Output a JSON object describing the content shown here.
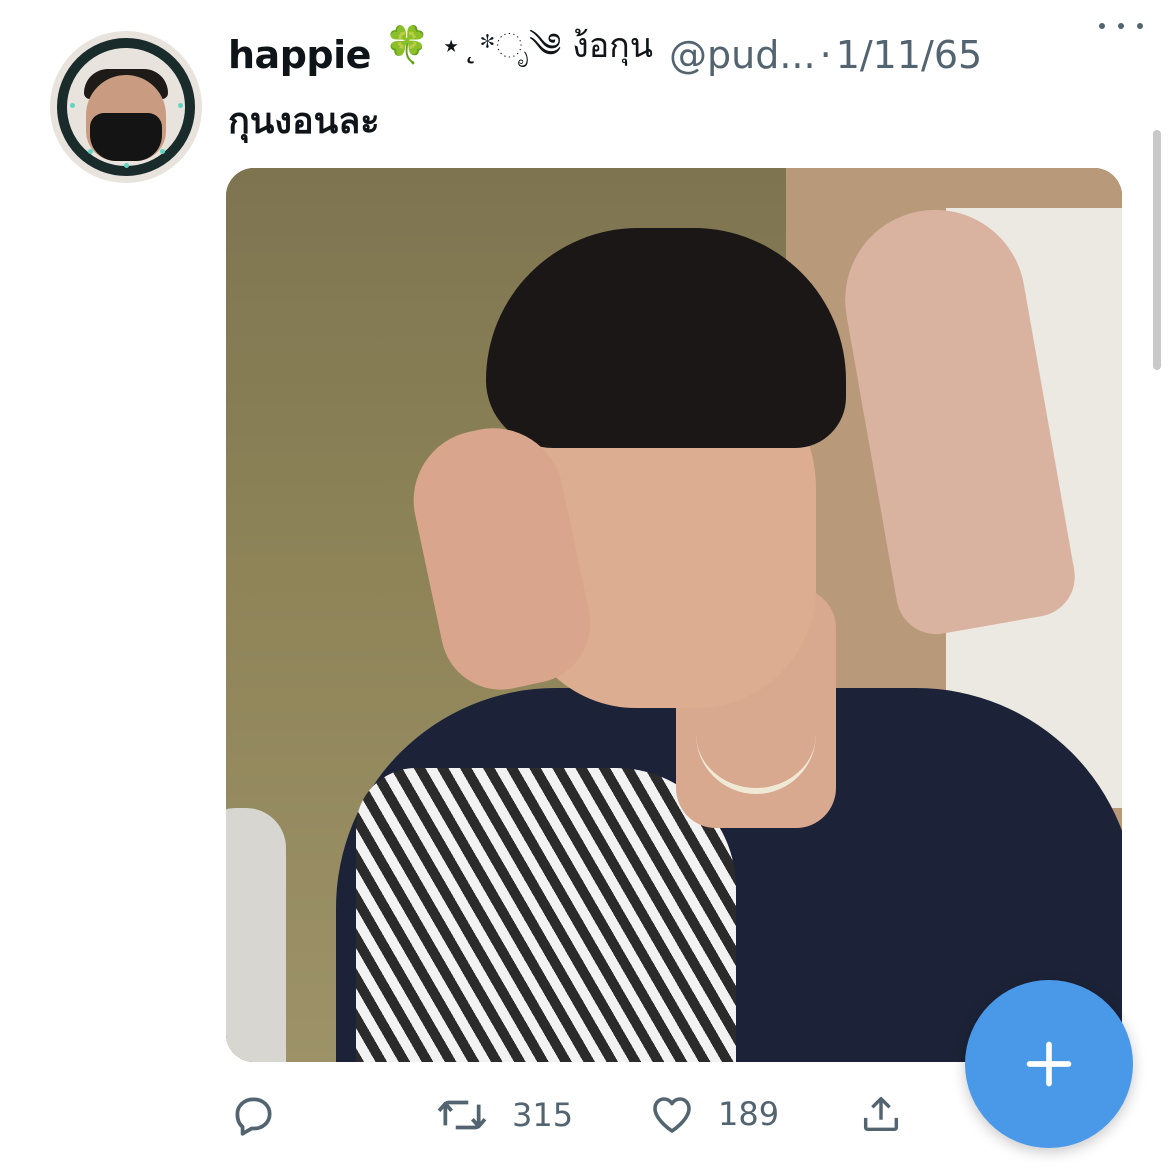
{
  "tweet": {
    "display_name": "happie",
    "name_clover": "🍀",
    "name_deco": "⋆˛*ೃ༄ ง้อกุน",
    "handle": "@pud...",
    "separator": "·",
    "date": "1/11/65",
    "text": "กุนงอนละ"
  },
  "actions": {
    "reply_icon": "speech-bubble-icon",
    "retweet_icon": "retweet-arrows-icon",
    "retweet_count": "315",
    "like_icon": "heart-icon",
    "like_count": "189",
    "share_icon": "share-upload-icon"
  },
  "fab": {
    "icon": "plus-icon",
    "color": "#4a99e9"
  },
  "colors": {
    "text": "#0f1419",
    "secondary": "#536471",
    "accent": "#4a99e9"
  }
}
